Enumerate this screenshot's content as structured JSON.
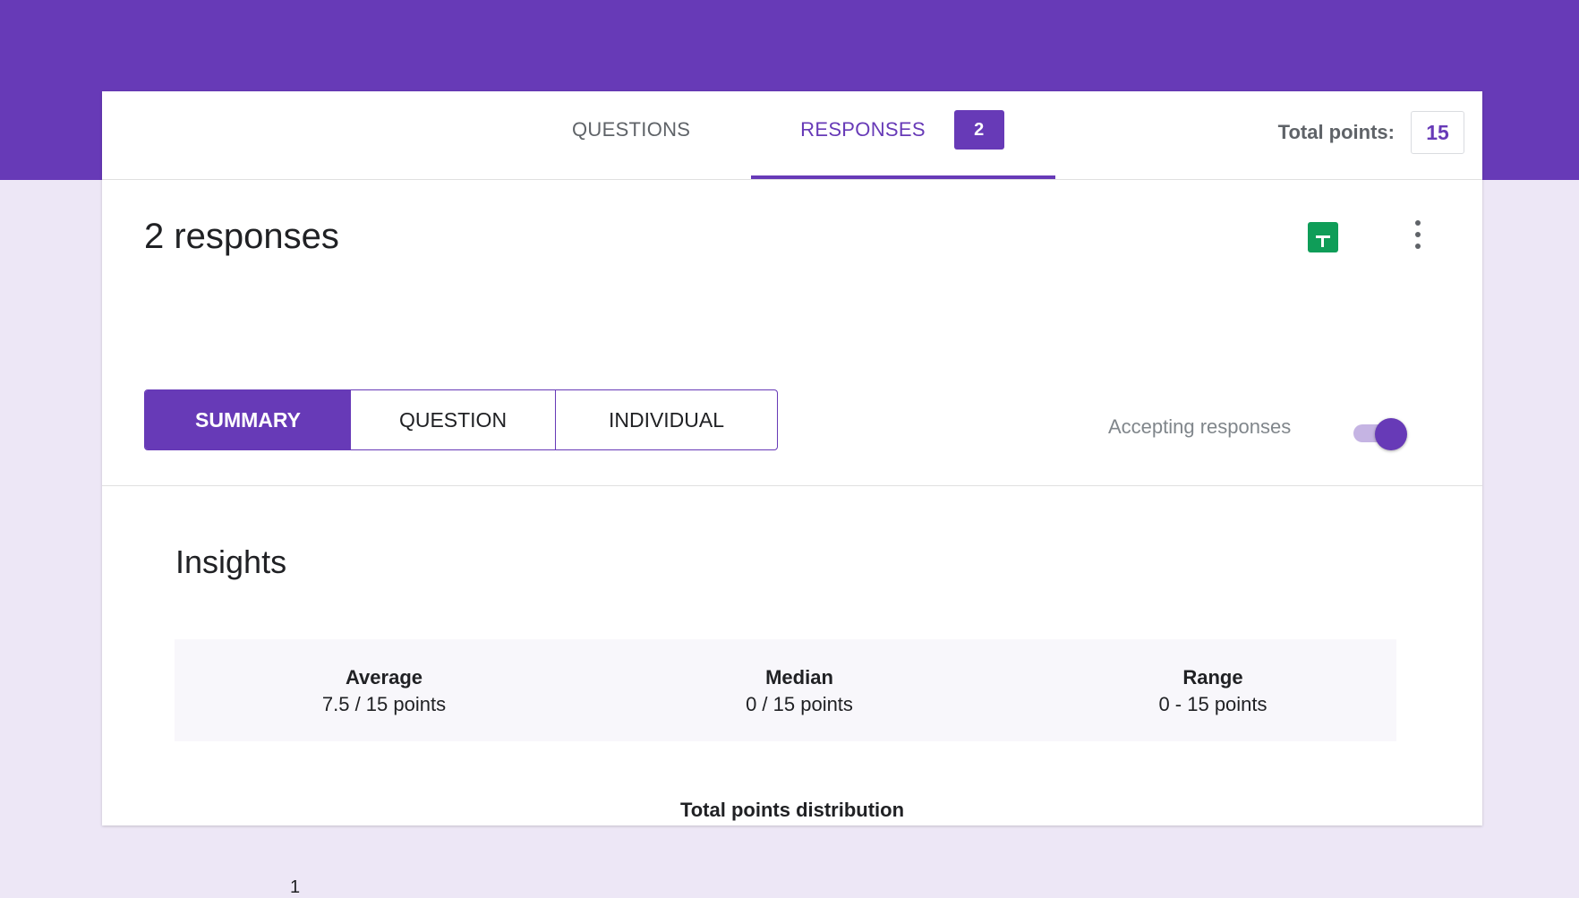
{
  "tabs": {
    "questions_label": "QUESTIONS",
    "responses_label": "RESPONSES",
    "responses_count": "2"
  },
  "total_points": {
    "label": "Total points:",
    "value": "15"
  },
  "header": {
    "title": "2 responses"
  },
  "view_tabs": {
    "summary": "SUMMARY",
    "question": "QUESTION",
    "individual": "INDIVIDUAL"
  },
  "accepting": {
    "label": "Accepting responses",
    "enabled": true
  },
  "insights": {
    "title": "Insights",
    "stats": [
      {
        "label": "Average",
        "value": "7.5 / 15 points"
      },
      {
        "label": "Median",
        "value": "0 / 15 points"
      },
      {
        "label": "Range",
        "value": "0 - 15 points"
      }
    ]
  },
  "distribution": {
    "title": "Total points distribution",
    "first_y_tick": "1"
  },
  "colors": {
    "brand": "#673ab7",
    "sheets": "#0f9d58",
    "background": "#ede7f6"
  },
  "icons": {
    "sheets": "create-spreadsheet-icon",
    "more": "more-vert-icon"
  }
}
